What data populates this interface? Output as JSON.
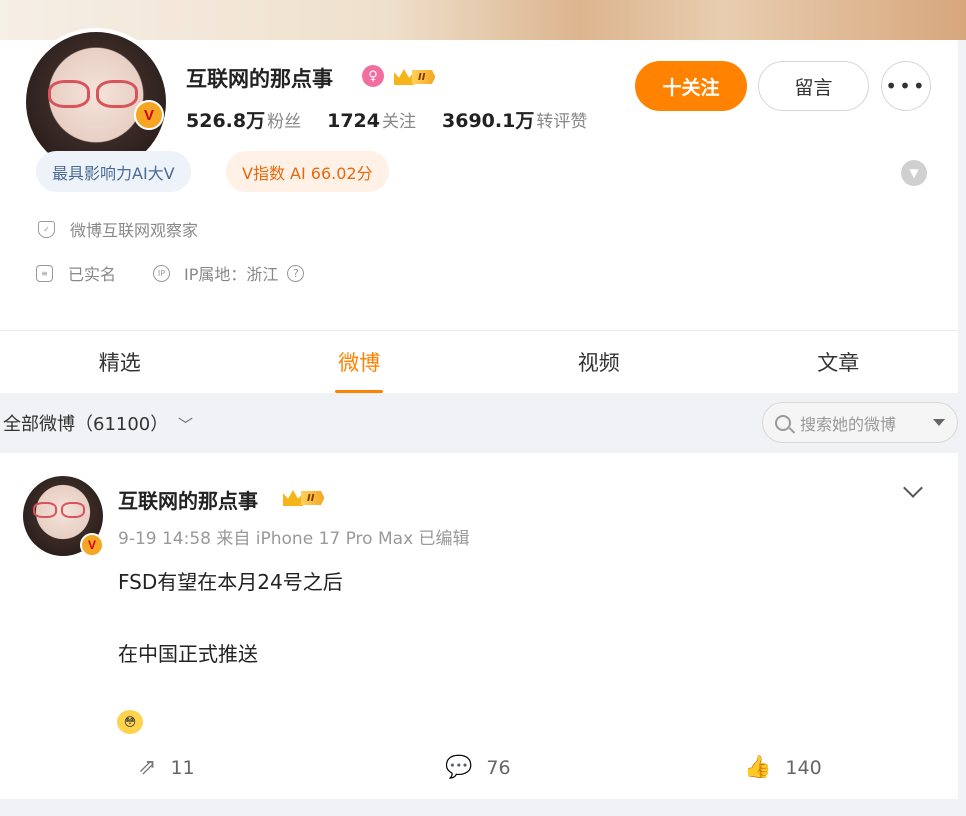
{
  "profile": {
    "name": "互联网的那点事",
    "gender_icon": "female-icon",
    "vip_level": "II",
    "verified_badge": "V",
    "stats": [
      {
        "value": "526.8万",
        "label": "粉丝"
      },
      {
        "value": "1724",
        "label": "关注"
      },
      {
        "value": "3690.1万",
        "label": "转评赞"
      }
    ],
    "follow_label": "十关注",
    "message_label": "留言",
    "more_label": "•••",
    "tags": [
      "最具影响力AI大V",
      "V指数 AI 66.02分"
    ],
    "description": "微博互联网观察家",
    "real_name": "已实名",
    "ip_location": "IP属地：浙江"
  },
  "tabs": [
    "精选",
    "微博",
    "视频",
    "文章"
  ],
  "active_tab": "微博",
  "filter": {
    "label": "全部微博（61100）",
    "search_placeholder": "搜索她的微博"
  },
  "post": {
    "author": "互联网的那点事",
    "vip_level": "II",
    "meta": "9-19 14:58 来自 iPhone 17 Pro Max 已编辑",
    "lines": [
      "FSD有望在本月24号之后",
      "在中国正式推送"
    ],
    "emoji": "😳",
    "reposts": "11",
    "comments": "76",
    "likes": "140"
  },
  "colors": {
    "accent": "#ff8200",
    "tag_blue": "#4a6a93",
    "tag_orange": "#e46a10"
  }
}
